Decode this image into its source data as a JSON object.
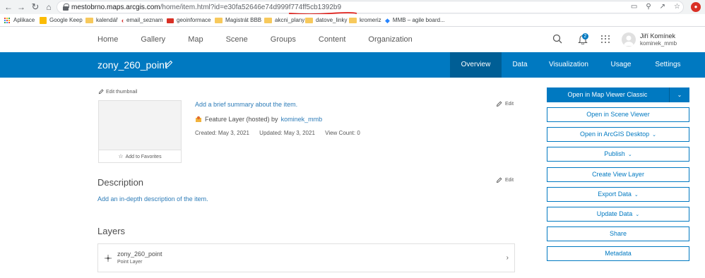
{
  "browser": {
    "url_host": "mestobrno.maps.arcgis.com",
    "url_path": "/home/item.html?id=e30fa52646e74d999f774ff5cb1392b9",
    "underline_color": "#e0201b"
  },
  "bookmarks": [
    {
      "label": "Aplikace",
      "icon": "apps-grid-icon"
    },
    {
      "label": "Google Keep",
      "icon": "keep-icon"
    },
    {
      "label": "kalendář",
      "icon": "folder-icon"
    },
    {
      "label": "email_seznam",
      "icon": "email-icon"
    },
    {
      "label": "geoinformace",
      "icon": "geo-icon"
    },
    {
      "label": "Magistrát BBB",
      "icon": "folder-icon"
    },
    {
      "label": "akcni_plany",
      "icon": "folder-icon"
    },
    {
      "label": "datove_linky",
      "icon": "folder-icon"
    },
    {
      "label": "kromeriz",
      "icon": "folder-icon"
    },
    {
      "label": "MMB – agile board...",
      "icon": "jira-icon"
    }
  ],
  "site_nav": [
    "Home",
    "Gallery",
    "Map",
    "Scene",
    "Groups",
    "Content",
    "Organization"
  ],
  "user": {
    "name": "Jiří Komínek",
    "username": "kominek_mmb",
    "notifications": "2"
  },
  "item": {
    "title": "zony_260_point",
    "tabs": [
      "Overview",
      "Data",
      "Visualization",
      "Usage",
      "Settings"
    ],
    "active_tab": "Overview"
  },
  "overview": {
    "edit_thumbnail": "Edit thumbnail",
    "add_favorites": "Add to Favorites",
    "summary_link": "Add a brief summary about the item.",
    "edit_label": "Edit",
    "type_text": "Feature Layer (hosted) by",
    "owner": "kominek_mmb",
    "created": "Created: May 3, 2021",
    "updated": "Updated: May 3, 2021",
    "view_count": "View Count: 0",
    "description_heading": "Description",
    "description_link": "Add an in-depth description of the item.",
    "layers_heading": "Layers",
    "layer": {
      "name": "zony_260_point",
      "type": "Point Layer"
    }
  },
  "actions": {
    "primary": "Open in Map Viewer Classic",
    "buttons": [
      {
        "label": "Open in Scene Viewer",
        "dropdown": false
      },
      {
        "label": "Open in ArcGIS Desktop",
        "dropdown": true
      },
      {
        "label": "Publish",
        "dropdown": true
      },
      {
        "label": "Create View Layer",
        "dropdown": false
      },
      {
        "label": "Export Data",
        "dropdown": true
      },
      {
        "label": "Update Data",
        "dropdown": true
      },
      {
        "label": "Share",
        "dropdown": false
      },
      {
        "label": "Metadata",
        "dropdown": false
      }
    ]
  },
  "colors": {
    "brand_blue": "#0079c1",
    "active_tab": "#005e95",
    "link": "#2d7cb8"
  }
}
